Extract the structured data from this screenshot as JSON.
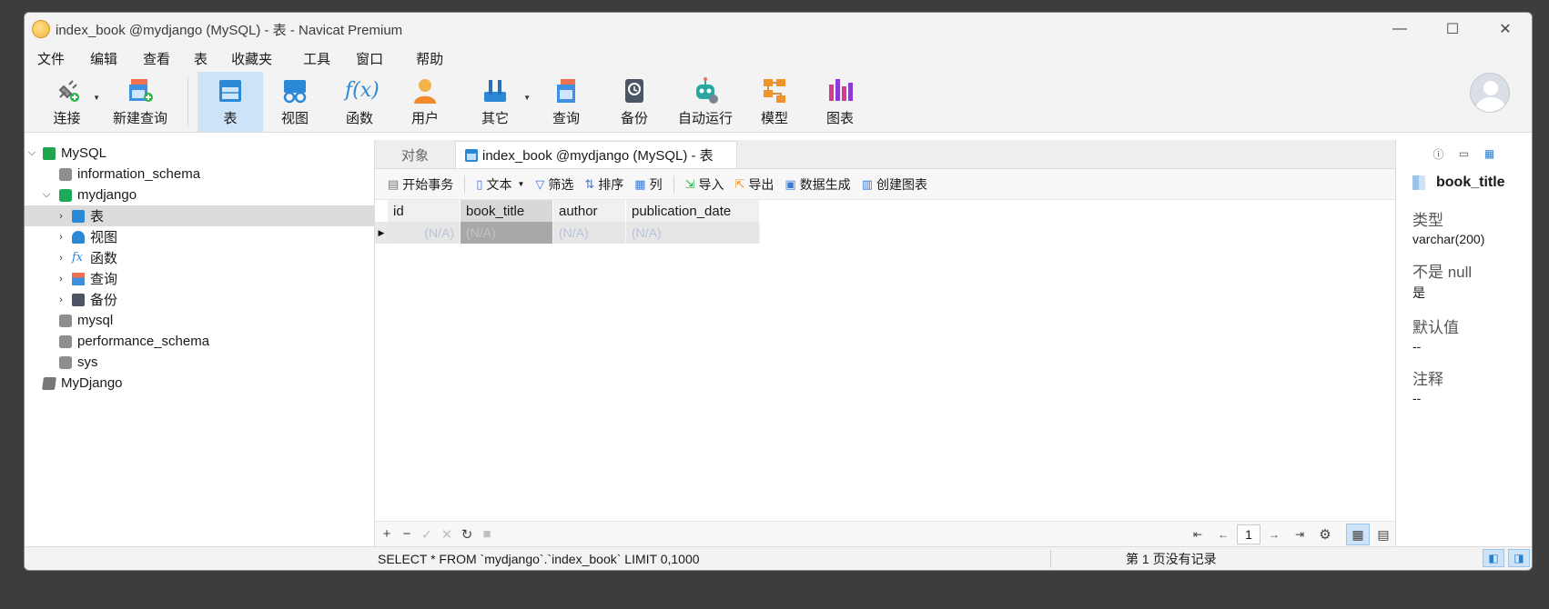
{
  "window": {
    "title": "index_book @mydjango (MySQL) - 表 - Navicat Premium",
    "controls": [
      "—",
      "☐",
      "✕"
    ]
  },
  "menu": [
    "文件",
    "编辑",
    "查看",
    "表",
    "收藏夹",
    "工具",
    "窗口",
    "帮助"
  ],
  "toolbar": {
    "connect": "连接",
    "new_query": "新建查询",
    "table": "表",
    "view": "视图",
    "function": "函数",
    "user": "用户",
    "other": "其它",
    "query": "查询",
    "backup": "备份",
    "automation": "自动运行",
    "model": "模型",
    "chart": "图表",
    "fx_glyph": "f(x)"
  },
  "sidebar": {
    "connection": "MySQL",
    "items": {
      "information_schema": "information_schema",
      "mydjango": "mydjango",
      "table": "表",
      "view": "视图",
      "function": "函数",
      "query": "查询",
      "backup": "备份",
      "mysql": "mysql",
      "performance_schema": "performance_schema",
      "sys": "sys"
    },
    "connection2": "MyDjango",
    "fx_glyph": "fx"
  },
  "tabs": {
    "objects": "对象",
    "active": "index_book @mydjango (MySQL) - 表"
  },
  "subtoolbar": {
    "begin_tx": "开始事务",
    "text": "文本",
    "filter": "筛选",
    "sort": "排序",
    "columns": "列",
    "import": "导入",
    "export": "导出",
    "data_gen": "数据生成",
    "create_chart": "创建图表"
  },
  "grid": {
    "columns": [
      "id",
      "book_title",
      "author",
      "publication_date"
    ],
    "row": [
      "(N/A)",
      "(N/A)",
      "(N/A)",
      "(N/A)"
    ]
  },
  "pager": {
    "page": "1"
  },
  "rightpanel": {
    "field": "book_title",
    "type_label": "类型",
    "type_value": "varchar(200)",
    "notnull_label": "不是 null",
    "notnull_value": "是",
    "default_label": "默认值",
    "default_value": "--",
    "comment_label": "注释",
    "comment_value": "--"
  },
  "status": {
    "sql": "SELECT * FROM `mydjango`.`index_book` LIMIT 0,1000",
    "page_info": "第 1 页没有记录"
  },
  "colors": {
    "accent": "#2a7fd4",
    "selection": "#cde3f7",
    "mysql_green": "#1ea54e"
  }
}
